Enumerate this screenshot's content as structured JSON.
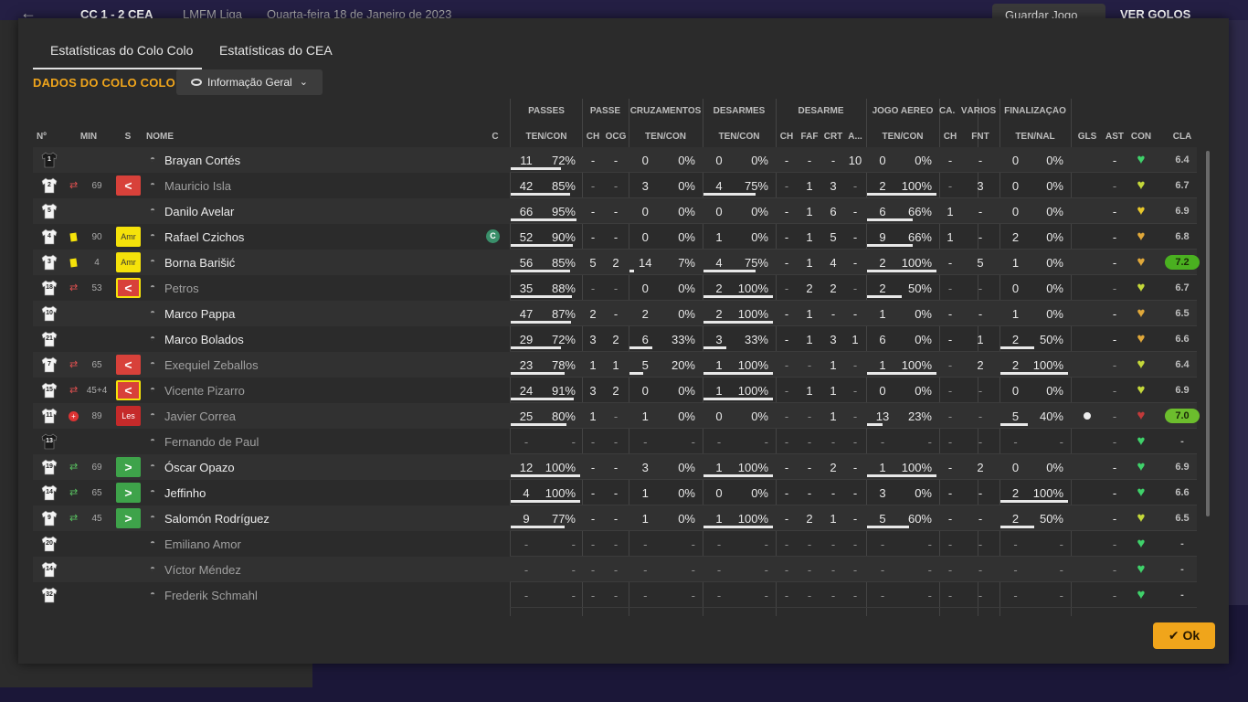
{
  "background": {
    "score": "CC 1 - 2 CEA",
    "league": "LMFM Liga",
    "date": "Quarta-feira 18 de Janeiro de 2023",
    "save_label": "Guardar Jogo",
    "goals_label": "VER GOLOS"
  },
  "tabs": [
    {
      "label": "Estatísticas do Colo Colo",
      "active": true
    },
    {
      "label": "Estatísticas do CEA",
      "active": false
    }
  ],
  "section_title": "DADOS DO COLO COLO",
  "view_dropdown": "Informação Geral",
  "group_headers": {
    "passes": "PASSES",
    "passe": "PASSE",
    "cruzamentos": "CRUZAMENTOS",
    "desarmes": "DESARMES",
    "desarme": "DESARME",
    "jogo_aereo": "JOGO AÉREO",
    "ca": "CA...",
    "varios": "VÁRIOS",
    "finalizacao": "FINALIZAÇÃO"
  },
  "col_headers": {
    "n": "Nº",
    "min": "MIN",
    "s": "S",
    "nome": "NOME",
    "c": "C",
    "pas_tc": "TEN/CON",
    "pa_ch": "CH",
    "pa_ocg": "OCG",
    "cr_tc": "TEN/CON",
    "ds_tc": "TEN/CON",
    "d_ch": "CH",
    "d_faf": "FAF",
    "d_crt": "CRT",
    "d_a": "A...",
    "ja_tc": "TEN/CON",
    "ca_ch": "CH",
    "v_fnt": "FNT",
    "f_tn": "TEN/NAL",
    "gls": "GLS",
    "ast": "AST",
    "con": "CON",
    "cla": "CLA"
  },
  "players": [
    {
      "num": "1",
      "kit": "gk",
      "min": "",
      "sub": "",
      "badge": "",
      "name": "Brayan Cortés",
      "dim": false,
      "cap": false,
      "ps": [
        "11",
        "72%"
      ],
      "pch": "-",
      "pocg": "-",
      "cr": [
        "0",
        "0%"
      ],
      "ds": [
        "0",
        "0%"
      ],
      "dch": "-",
      "dfaf": "-",
      "dcrt": "-",
      "da": "10",
      "ja": [
        "0",
        "0%"
      ],
      "cach": "-",
      "fnt": "-",
      "fin": [
        "0",
        "0%"
      ],
      "gls": "",
      "ast": "-",
      "con": "green",
      "cla": "6.4",
      "cla_style": ""
    },
    {
      "num": "2",
      "kit": "out",
      "min": "69",
      "sub": "out",
      "badge": "out",
      "name": "Mauricio Isla",
      "dim": true,
      "cap": false,
      "ps": [
        "42",
        "85%"
      ],
      "pch": "-",
      "pocg": "-",
      "cr": [
        "3",
        "0%"
      ],
      "ds": [
        "4",
        "75%"
      ],
      "dch": "-",
      "dfaf": "1",
      "dcrt": "3",
      "da": "-",
      "ja": [
        "2",
        "100%"
      ],
      "cach": "-",
      "fnt": "3",
      "fin": [
        "0",
        "0%"
      ],
      "gls": "",
      "ast": "-",
      "con": "yellowgreen",
      "cla": "6.7",
      "cla_style": ""
    },
    {
      "num": "5",
      "kit": "out",
      "min": "",
      "sub": "",
      "badge": "",
      "name": "Danilo Avelar",
      "dim": false,
      "cap": false,
      "ps": [
        "66",
        "95%"
      ],
      "pch": "-",
      "pocg": "-",
      "cr": [
        "0",
        "0%"
      ],
      "ds": [
        "0",
        "0%"
      ],
      "dch": "-",
      "dfaf": "1",
      "dcrt": "6",
      "da": "-",
      "ja": [
        "6",
        "66%"
      ],
      "cach": "1",
      "fnt": "-",
      "fin": [
        "0",
        "0%"
      ],
      "gls": "",
      "ast": "-",
      "con": "yellow",
      "cla": "6.9",
      "cla_style": ""
    },
    {
      "num": "4",
      "kit": "out",
      "min": "90",
      "sub": "ycard",
      "badge": "amr",
      "name": "Rafael Czichos",
      "dim": false,
      "cap": true,
      "ps": [
        "52",
        "90%"
      ],
      "pch": "-",
      "pocg": "-",
      "cr": [
        "0",
        "0%"
      ],
      "ds": [
        "1",
        "0%"
      ],
      "dch": "-",
      "dfaf": "1",
      "dcrt": "5",
      "da": "-",
      "ja": [
        "9",
        "66%"
      ],
      "cach": "1",
      "fnt": "-",
      "fin": [
        "2",
        "0%"
      ],
      "gls": "",
      "ast": "-",
      "con": "orange",
      "cla": "6.8",
      "cla_style": ""
    },
    {
      "num": "3",
      "kit": "out",
      "min": "4",
      "sub": "ycard",
      "badge": "amr",
      "name": "Borna Barišić",
      "dim": false,
      "cap": false,
      "ps": [
        "56",
        "85%"
      ],
      "pch": "5",
      "pocg": "2",
      "cr": [
        "14",
        "7%"
      ],
      "ds": [
        "4",
        "75%"
      ],
      "dch": "-",
      "dfaf": "1",
      "dcrt": "4",
      "da": "-",
      "ja": [
        "2",
        "100%"
      ],
      "cach": "-",
      "fnt": "5",
      "fin": [
        "1",
        "0%"
      ],
      "gls": "",
      "ast": "-",
      "con": "orange",
      "cla": "7.2",
      "cla_style": "good"
    },
    {
      "num": "18",
      "kit": "out",
      "min": "53",
      "sub": "out",
      "badge": "outy",
      "name": "Petros",
      "dim": true,
      "cap": false,
      "ps": [
        "35",
        "88%"
      ],
      "pch": "-",
      "pocg": "-",
      "cr": [
        "0",
        "0%"
      ],
      "ds": [
        "2",
        "100%"
      ],
      "dch": "-",
      "dfaf": "2",
      "dcrt": "2",
      "da": "-",
      "ja": [
        "2",
        "50%"
      ],
      "cach": "-",
      "fnt": "-",
      "fin": [
        "0",
        "0%"
      ],
      "gls": "",
      "ast": "-",
      "con": "yellowgreen",
      "cla": "6.7",
      "cla_style": ""
    },
    {
      "num": "10",
      "kit": "out",
      "min": "",
      "sub": "",
      "badge": "",
      "name": "Marco Pappa",
      "dim": false,
      "cap": false,
      "ps": [
        "47",
        "87%"
      ],
      "pch": "2",
      "pocg": "-",
      "cr": [
        "2",
        "0%"
      ],
      "ds": [
        "2",
        "100%"
      ],
      "dch": "-",
      "dfaf": "1",
      "dcrt": "-",
      "da": "-",
      "ja": [
        "1",
        "0%"
      ],
      "cach": "-",
      "fnt": "-",
      "fin": [
        "1",
        "0%"
      ],
      "gls": "",
      "ast": "-",
      "con": "orange",
      "cla": "6.5",
      "cla_style": ""
    },
    {
      "num": "21",
      "kit": "out",
      "min": "",
      "sub": "",
      "badge": "",
      "name": "Marco Bolados",
      "dim": false,
      "cap": false,
      "ps": [
        "29",
        "72%"
      ],
      "pch": "3",
      "pocg": "2",
      "cr": [
        "6",
        "33%"
      ],
      "ds": [
        "3",
        "33%"
      ],
      "dch": "-",
      "dfaf": "1",
      "dcrt": "3",
      "da": "1",
      "ja": [
        "6",
        "0%"
      ],
      "cach": "-",
      "fnt": "1",
      "fin": [
        "2",
        "50%"
      ],
      "gls": "",
      "ast": "-",
      "con": "orange",
      "cla": "6.6",
      "cla_style": ""
    },
    {
      "num": "7",
      "kit": "out",
      "min": "65",
      "sub": "out",
      "badge": "out",
      "name": "Exequiel Zeballos",
      "dim": true,
      "cap": false,
      "ps": [
        "23",
        "78%"
      ],
      "pch": "1",
      "pocg": "1",
      "cr": [
        "5",
        "20%"
      ],
      "ds": [
        "1",
        "100%"
      ],
      "dch": "-",
      "dfaf": "-",
      "dcrt": "1",
      "da": "-",
      "ja": [
        "1",
        "100%"
      ],
      "cach": "-",
      "fnt": "2",
      "fin": [
        "2",
        "100%"
      ],
      "gls": "",
      "ast": "-",
      "con": "yellowgreen",
      "cla": "6.4",
      "cla_style": ""
    },
    {
      "num": "15",
      "kit": "out",
      "min": "45+4",
      "sub": "out",
      "badge": "outy",
      "name": "Vicente Pizarro",
      "dim": true,
      "cap": false,
      "ps": [
        "24",
        "91%"
      ],
      "pch": "3",
      "pocg": "2",
      "cr": [
        "0",
        "0%"
      ],
      "ds": [
        "1",
        "100%"
      ],
      "dch": "-",
      "dfaf": "1",
      "dcrt": "1",
      "da": "-",
      "ja": [
        "0",
        "0%"
      ],
      "cach": "-",
      "fnt": "-",
      "fin": [
        "0",
        "0%"
      ],
      "gls": "",
      "ast": "-",
      "con": "yellowgreen",
      "cla": "6.9",
      "cla_style": ""
    },
    {
      "num": "11",
      "kit": "out",
      "min": "89",
      "sub": "injury",
      "badge": "les",
      "name": "Javier Correa",
      "dim": true,
      "cap": false,
      "ps": [
        "25",
        "80%"
      ],
      "pch": "1",
      "pocg": "-",
      "cr": [
        "1",
        "0%"
      ],
      "ds": [
        "0",
        "0%"
      ],
      "dch": "-",
      "dfaf": "-",
      "dcrt": "1",
      "da": "-",
      "ja": [
        "13",
        "23%"
      ],
      "cach": "-",
      "fnt": "-",
      "fin": [
        "5",
        "40%"
      ],
      "gls": "ball",
      "ast": "-",
      "con": "red",
      "cla": "7.0",
      "cla_style": "best"
    },
    {
      "num": "13",
      "kit": "gk",
      "min": "",
      "sub": "",
      "badge": "",
      "name": "Fernando de Paul",
      "dim": true,
      "cap": false,
      "ps": [
        "-",
        "-"
      ],
      "pch": "-",
      "pocg": "-",
      "cr": [
        "-",
        "-"
      ],
      "ds": [
        "-",
        "-"
      ],
      "dch": "-",
      "dfaf": "-",
      "dcrt": "-",
      "da": "-",
      "ja": [
        "-",
        "-"
      ],
      "cach": "-",
      "fnt": "-",
      "fin": [
        "-",
        "-"
      ],
      "gls": "",
      "ast": "-",
      "con": "green",
      "cla": "-",
      "cla_style": ""
    },
    {
      "num": "19",
      "kit": "out",
      "min": "69",
      "sub": "in",
      "badge": "in",
      "name": "Óscar Opazo",
      "dim": false,
      "cap": false,
      "ps": [
        "12",
        "100%"
      ],
      "pch": "-",
      "pocg": "-",
      "cr": [
        "3",
        "0%"
      ],
      "ds": [
        "1",
        "100%"
      ],
      "dch": "-",
      "dfaf": "-",
      "dcrt": "2",
      "da": "-",
      "ja": [
        "1",
        "100%"
      ],
      "cach": "-",
      "fnt": "2",
      "fin": [
        "0",
        "0%"
      ],
      "gls": "",
      "ast": "-",
      "con": "green",
      "cla": "6.9",
      "cla_style": ""
    },
    {
      "num": "14",
      "kit": "out",
      "min": "65",
      "sub": "in",
      "badge": "in",
      "name": "Jeffinho",
      "dim": false,
      "cap": false,
      "ps": [
        "4",
        "100%"
      ],
      "pch": "-",
      "pocg": "-",
      "cr": [
        "1",
        "0%"
      ],
      "ds": [
        "0",
        "0%"
      ],
      "dch": "-",
      "dfaf": "-",
      "dcrt": "-",
      "da": "-",
      "ja": [
        "3",
        "0%"
      ],
      "cach": "-",
      "fnt": "-",
      "fin": [
        "2",
        "100%"
      ],
      "gls": "",
      "ast": "-",
      "con": "green",
      "cla": "6.6",
      "cla_style": ""
    },
    {
      "num": "9",
      "kit": "out",
      "min": "45",
      "sub": "in",
      "badge": "in",
      "name": "Salomón Rodríguez",
      "dim": false,
      "cap": false,
      "ps": [
        "9",
        "77%"
      ],
      "pch": "-",
      "pocg": "-",
      "cr": [
        "1",
        "0%"
      ],
      "ds": [
        "1",
        "100%"
      ],
      "dch": "-",
      "dfaf": "2",
      "dcrt": "1",
      "da": "-",
      "ja": [
        "5",
        "60%"
      ],
      "cach": "-",
      "fnt": "-",
      "fin": [
        "2",
        "50%"
      ],
      "gls": "",
      "ast": "-",
      "con": "yellowgreen",
      "cla": "6.5",
      "cla_style": ""
    },
    {
      "num": "20",
      "kit": "out",
      "min": "",
      "sub": "",
      "badge": "",
      "name": "Emiliano Amor",
      "dim": true,
      "cap": false,
      "ps": [
        "-",
        "-"
      ],
      "pch": "-",
      "pocg": "-",
      "cr": [
        "-",
        "-"
      ],
      "ds": [
        "-",
        "-"
      ],
      "dch": "-",
      "dfaf": "-",
      "dcrt": "-",
      "da": "-",
      "ja": [
        "-",
        "-"
      ],
      "cach": "-",
      "fnt": "-",
      "fin": [
        "-",
        "-"
      ],
      "gls": "",
      "ast": "-",
      "con": "green",
      "cla": "-",
      "cla_style": ""
    },
    {
      "num": "14",
      "kit": "out",
      "min": "",
      "sub": "",
      "badge": "",
      "name": "Víctor Méndez",
      "dim": true,
      "cap": false,
      "ps": [
        "-",
        "-"
      ],
      "pch": "-",
      "pocg": "-",
      "cr": [
        "-",
        "-"
      ],
      "ds": [
        "-",
        "-"
      ],
      "dch": "-",
      "dfaf": "-",
      "dcrt": "-",
      "da": "-",
      "ja": [
        "-",
        "-"
      ],
      "cach": "-",
      "fnt": "-",
      "fin": [
        "-",
        "-"
      ],
      "gls": "",
      "ast": "-",
      "con": "green",
      "cla": "-",
      "cla_style": ""
    },
    {
      "num": "32",
      "kit": "out",
      "min": "",
      "sub": "",
      "badge": "",
      "name": "Frederik Schmahl",
      "dim": true,
      "cap": false,
      "ps": [
        "-",
        "-"
      ],
      "pch": "-",
      "pocg": "-",
      "cr": [
        "-",
        "-"
      ],
      "ds": [
        "-",
        "-"
      ],
      "dch": "-",
      "dfaf": "-",
      "dcrt": "-",
      "da": "-",
      "ja": [
        "-",
        "-"
      ],
      "cach": "-",
      "fnt": "-",
      "fin": [
        "-",
        "-"
      ],
      "gls": "",
      "ast": "-",
      "con": "green",
      "cla": "-",
      "cla_style": ""
    }
  ],
  "badge_labels": {
    "amr": "Amr",
    "les": "Les",
    "out": "<",
    "in": ">",
    "captain": "C"
  },
  "colors": {
    "accent": "#f0a51b",
    "sub_out": "#d8413a",
    "sub_in": "#3ea34a",
    "yellow": "#f5e20a"
  },
  "ok_label": "Ok"
}
